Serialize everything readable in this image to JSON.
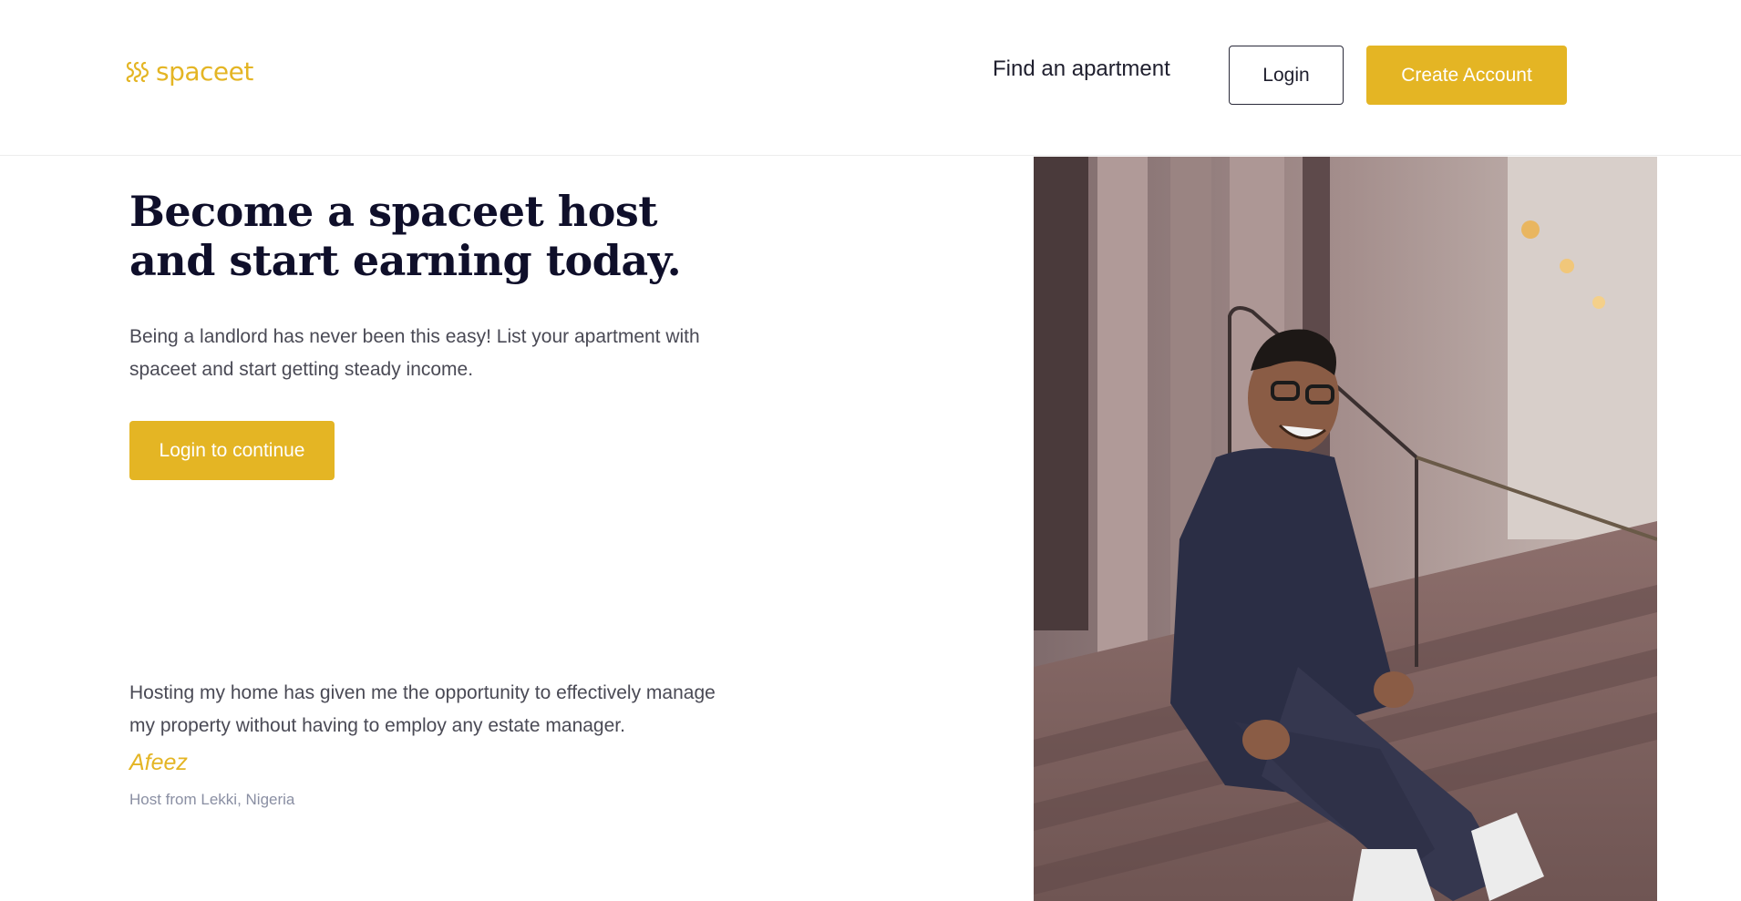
{
  "brand": {
    "name": "spaceet",
    "accent_color": "#e4b524"
  },
  "header": {
    "find_apartment": "Find an apartment",
    "login": "Login",
    "create_account": "Create Account"
  },
  "hero": {
    "title": "Become a spaceet host and start earning today.",
    "subtitle": "Being a landlord has never been this easy! List your apartment with spaceet and start getting steady income.",
    "cta": "Login to continue"
  },
  "testimonial": {
    "quote": "Hosting my home has given me the opportunity to effectively manage my property without having to employ any estate manager.",
    "author": "Afeez",
    "location": "Host from Lekki, Nigeria"
  },
  "photo": {
    "subject": "smiling man with glasses sitting on building steps"
  }
}
